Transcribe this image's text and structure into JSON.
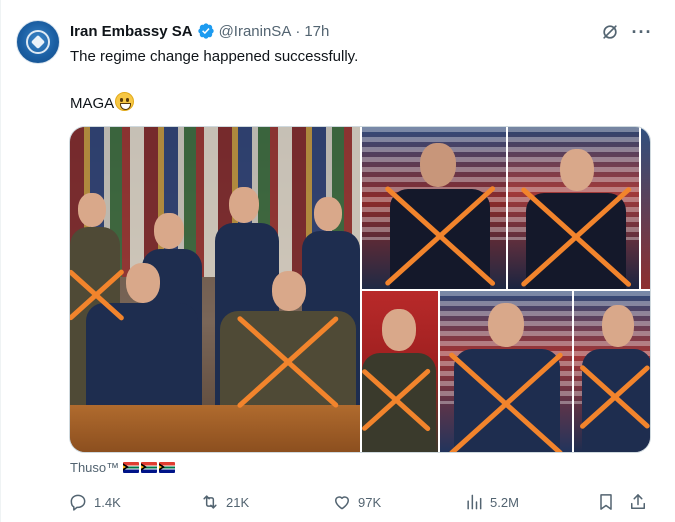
{
  "tweet": {
    "display_name": "Iran Embassy SA",
    "handle": "@IraninSA",
    "separator": "·",
    "time": "17h",
    "text_line1": "The regime change happened successfully.",
    "text_line2": "MAGA",
    "text_line2_emoji": "grinning-face-emoji",
    "media_caption": "Thuso™",
    "caption_flags": [
      "south-africa-flag",
      "south-africa-flag",
      "south-africa-flag"
    ],
    "overlay_mark": "orange-x",
    "overlay_color": "#f2842c"
  },
  "actions": {
    "replies": "1.4K",
    "retweets": "21K",
    "likes": "97K",
    "views": "5.2M"
  },
  "colors": {
    "text_primary": "#0f1419",
    "text_secondary": "#536471",
    "verified": "#1d9bf0",
    "border": "#cfd9de"
  },
  "icons": [
    "grok-icon",
    "more-icon",
    "verified-icon",
    "reply-icon",
    "retweet-icon",
    "like-icon",
    "views-icon",
    "bookmark-icon",
    "share-icon"
  ]
}
